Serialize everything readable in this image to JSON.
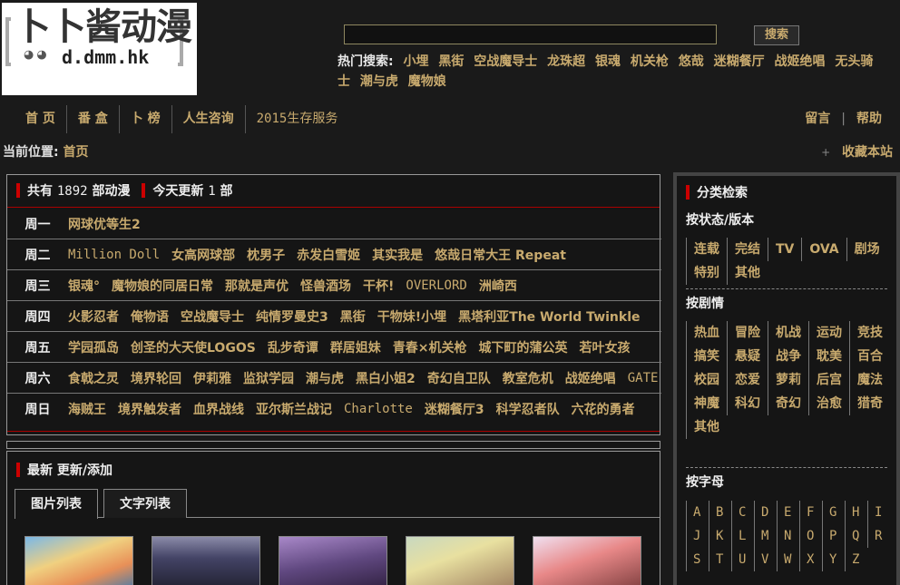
{
  "logo": {
    "title": "卜卜酱动漫",
    "domain": "d.dmm.hk",
    "eyes": "◕◕"
  },
  "search": {
    "button": "搜索"
  },
  "hot": {
    "label": "热门搜索:",
    "keywords": [
      "小埋",
      "黑街",
      "空战魔导士",
      "龙珠超",
      "银魂",
      "机关枪",
      "悠哉",
      "迷糊餐厅",
      "战姬绝唱",
      "无头骑士",
      "潮与虎",
      "魔物娘"
    ]
  },
  "nav": {
    "items": [
      "首 页",
      "番 盒",
      "卜 榜",
      "人生咨询",
      "2015生存服务"
    ],
    "right": [
      "留言",
      "帮助"
    ],
    "sep": "|"
  },
  "crumb": {
    "label": "当前位置:",
    "home": "首页"
  },
  "fav": {
    "plus": "+",
    "label": "收藏本站"
  },
  "week": {
    "head_a": "共有 ",
    "total": "1892",
    "head_b": " 部动漫",
    "today_a": "今天更新 ",
    "today": "1",
    "today_b": " 部",
    "days": [
      {
        "label": "周一",
        "items": [
          "网球优等生2"
        ]
      },
      {
        "label": "周二",
        "items": [
          "Million Doll",
          "女高网球部",
          "枕男子",
          "赤发白雪姬",
          "其实我是",
          "悠哉日常大王 Repeat"
        ]
      },
      {
        "label": "周三",
        "items": [
          "银魂°",
          "魔物娘的同居日常",
          "那就是声优",
          "怪兽酒场",
          "干杯!",
          "OVERLORD",
          "洲崎西"
        ]
      },
      {
        "label": "周四",
        "items": [
          "火影忍者",
          "俺物语",
          "空战魔导士",
          "纯情罗曼史3",
          "黑街",
          "干物妹!小埋",
          "黑塔利亚The World Twinkle"
        ]
      },
      {
        "label": "周五",
        "items": [
          "学园孤岛",
          "创圣的大天使LOGOS",
          "乱步奇谭",
          "群居姐妹",
          "青春×机关枪",
          "城下町的蒲公英",
          "若叶女孩"
        ]
      },
      {
        "label": "周六",
        "items": [
          "食戟之灵",
          "境界轮回",
          "伊莉雅",
          "监狱学园",
          "潮与虎",
          "黑白小姐2",
          "奇幻自卫队",
          "教室危机",
          "战姬绝唱",
          "GATE"
        ]
      },
      {
        "label": "周日",
        "items": [
          "海贼王",
          "境界触发者",
          "血界战线",
          "亚尔斯兰战记",
          "Charlotte",
          "迷糊餐厅3",
          "科学忍者队",
          "六花的勇者"
        ]
      }
    ]
  },
  "latest": {
    "head": "最新 更新/添加",
    "tabs": [
      "图片列表",
      "文字列表"
    ]
  },
  "side": {
    "head": "分类检索",
    "s1": "按状态/版本",
    "s1_tags": [
      "连载",
      "完结",
      "TV",
      "OVA",
      "剧场",
      "特别",
      "其他"
    ],
    "s2": "按剧情",
    "s2_tags": [
      "热血",
      "冒险",
      "机战",
      "运动",
      "竞技",
      "搞笑",
      "悬疑",
      "战争",
      "耽美",
      "百合",
      "校园",
      "恋爱",
      "萝莉",
      "后宫",
      "魔法",
      "神魔",
      "科幻",
      "奇幻",
      "治愈",
      "猎奇",
      "其他"
    ],
    "s3": "按字母",
    "s3_tags": [
      "A",
      "B",
      "C",
      "D",
      "E",
      "F",
      "G",
      "H",
      "I",
      "J",
      "K",
      "L",
      "M",
      "N",
      "O",
      "P",
      "Q",
      "R",
      "S",
      "T",
      "U",
      "V",
      "W",
      "X",
      "Y",
      "Z"
    ]
  }
}
